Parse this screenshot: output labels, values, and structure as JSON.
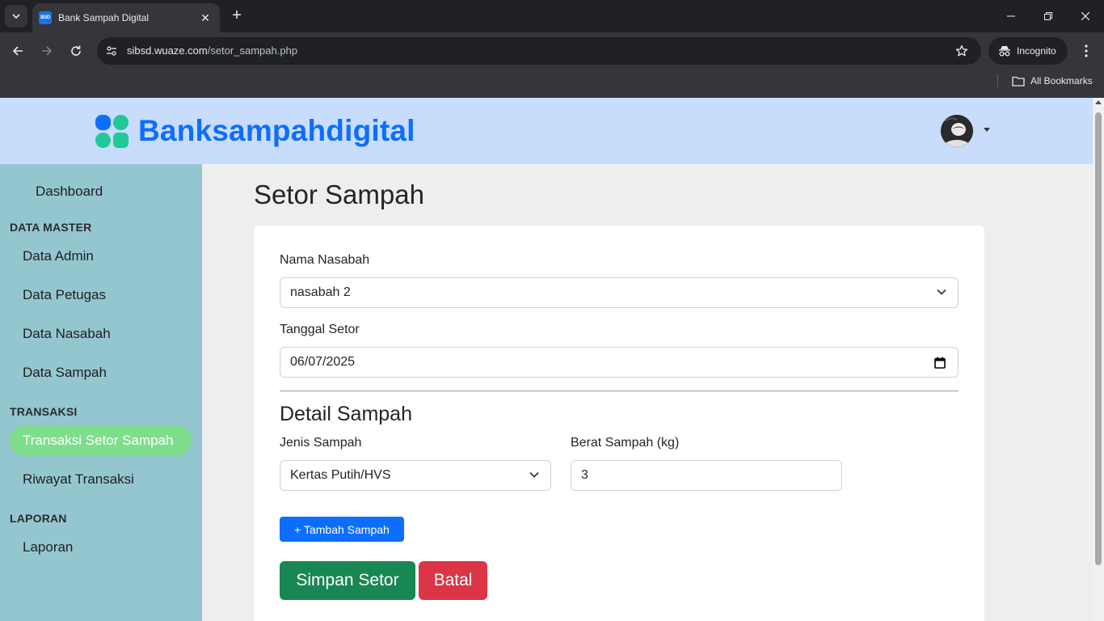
{
  "browser": {
    "tab_title": "Bank Sampah Digital",
    "tab_favicon_text": "BSD",
    "url_host": "sibsd.wuaze.com",
    "url_path": "/setor_sampah.php",
    "incognito_label": "Incognito",
    "bookmarks_label": "All Bookmarks",
    "new_tab_glyph": "+",
    "close_tab_glyph": "✕"
  },
  "header": {
    "brand": "Banksampahdigital",
    "brand_color": "#0d6efd",
    "logo_colors": [
      "#0d6efd",
      "#20c997"
    ]
  },
  "sidebar": {
    "dashboard": "Dashboard",
    "sections": {
      "master": "DATA MASTER",
      "transaksi": "TRANSAKSI",
      "laporan": "LAPORAN"
    },
    "items": {
      "data_admin": "Data Admin",
      "data_petugas": "Data Petugas",
      "data_nasabah": "Data Nasabah",
      "data_sampah": "Data Sampah",
      "transaksi_setor": "Transaksi Setor Sampah",
      "riwayat": "Riwayat Transaksi",
      "laporan": "Laporan"
    },
    "active_item": "Transaksi Setor Sampah"
  },
  "main": {
    "title": "Setor Sampah",
    "form": {
      "nasabah_label": "Nama Nasabah",
      "nasabah_value": "nasabah 2",
      "tanggal_label": "Tanggal Setor",
      "tanggal_value": "06/07/2025",
      "detail_title": "Detail Sampah",
      "jenis_label": "Jenis Sampah",
      "jenis_value": "Kertas Putih/HVS",
      "berat_label": "Berat Sampah (kg)",
      "berat_value": "3",
      "add_button": "+ Tambah Sampah",
      "save_button": "Simpan Setor",
      "cancel_button": "Batal"
    }
  }
}
